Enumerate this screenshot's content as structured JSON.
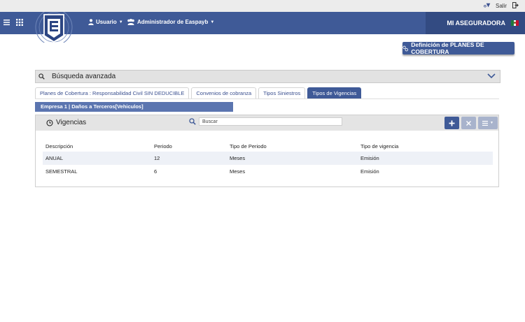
{
  "topbar": {
    "exit_label": "Salir"
  },
  "navbar": {
    "user_label": "Usuario",
    "admin_label": "Administrador de Easpayb",
    "company": "MI ASEGURADORA"
  },
  "definition_button": "Definición de PLANES DE COBERTURA",
  "advanced_search": {
    "title": "Búsqueda avanzada"
  },
  "tabs": [
    {
      "label": "Planes de Cobertura : Responsabilidad Civil SIN DEDUCIBLE"
    },
    {
      "label": "Convenios de cobranza"
    },
    {
      "label": "Tipos Siniestros"
    },
    {
      "label": "Tipos de Vigencias"
    }
  ],
  "subtab": "Empresa 1 | Daños a Terceros[Vehiculos]",
  "panel": {
    "title": "Vigencias",
    "search_placeholder": "Buscar"
  },
  "table": {
    "columns": [
      "Descripción",
      "Periodo",
      "Tipo de Periodo",
      "Tipo de vigencia"
    ],
    "rows": [
      [
        "ANUAL",
        "12",
        "Meses",
        "Emisión"
      ],
      [
        "SEMESTRAL",
        "6",
        "Meses",
        "Emisión"
      ]
    ]
  },
  "colors": {
    "primary": "#3f5a97",
    "primary_dark": "#334b82",
    "header_gray": "#e4e4e4"
  }
}
